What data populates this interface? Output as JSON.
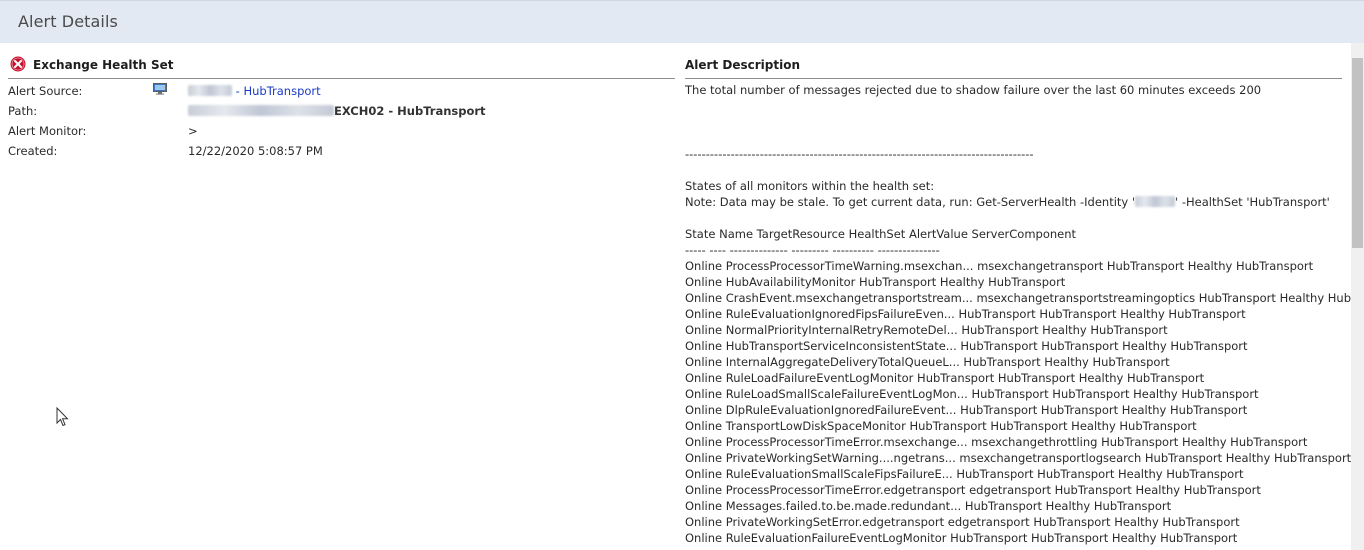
{
  "header": {
    "title": "Alert Details"
  },
  "alert": {
    "section_title": "Exchange Health Set",
    "source_label": "Alert Source:",
    "source_value_suffix": " - HubTransport",
    "path_label": "Path:",
    "path_value_suffix": "EXCH02 - HubTransport",
    "monitor_label": "Alert Monitor:",
    "monitor_value": ">",
    "created_label": "Created:",
    "created_value": "12/22/2020 5:08:57 PM"
  },
  "description": {
    "title": "Alert Description",
    "summary": "The total number of messages rejected due to shadow failure over the last 60 minutes exceeds 200",
    "separator": "------------------------------------------------------------------------------------",
    "states_intro": "States of all monitors within the health set:",
    "note_prefix": "Note: Data may be stale. To get current data, run: Get-ServerHealth -Identity '",
    "note_suffix": "' -HealthSet 'HubTransport'",
    "table_header": "State Name TargetResource HealthSet AlertValue ServerComponent",
    "table_rule": "----- ---- -------------- --------- ---------- ---------------",
    "rows": [
      "Online ProcessProcessorTimeWarning.msexchan... msexchangetransport HubTransport Healthy HubTransport",
      "Online HubAvailabilityMonitor HubTransport Healthy HubTransport",
      "Online CrashEvent.msexchangetransportstream... msexchangetransportstreamingoptics HubTransport Healthy HubTransport",
      "Online RuleEvaluationIgnoredFipsFailureEven... HubTransport HubTransport Healthy HubTransport",
      "Online NormalPriorityInternalRetryRemoteDel... HubTransport Healthy HubTransport",
      "Online HubTransportServiceInconsistentState... HubTransport HubTransport Healthy HubTransport",
      "Online InternalAggregateDeliveryTotalQueueL... HubTransport Healthy HubTransport",
      "Online RuleLoadFailureEventLogMonitor HubTransport HubTransport Healthy HubTransport",
      "Online RuleLoadSmallScaleFailureEventLogMon... HubTransport HubTransport Healthy HubTransport",
      "Online DlpRuleEvaluationIgnoredFailureEvent... HubTransport HubTransport Healthy HubTransport",
      "Online TransportLowDiskSpaceMonitor HubTransport HubTransport Healthy HubTransport",
      "Online ProcessProcessorTimeError.msexchange... msexchangethrottling HubTransport Healthy HubTransport",
      "Online PrivateWorkingSetWarning....ngetrans... msexchangetransportlogsearch HubTransport Healthy HubTransport",
      "Online RuleEvaluationSmallScaleFipsFailureE... HubTransport HubTransport Healthy HubTransport",
      "Online ProcessProcessorTimeError.edgetransport edgetransport HubTransport Healthy HubTransport",
      "Online Messages.failed.to.be.made.redundant... HubTransport Healthy HubTransport",
      "Online PrivateWorkingSetError.edgetransport edgetransport HubTransport Healthy HubTransport",
      "Online RuleEvaluationFailureEventLogMonitor HubTransport HubTransport Healthy HubTransport"
    ]
  },
  "icons": {
    "error": "error-circle-icon",
    "monitor": "monitor-icon",
    "cursor": "mouse-cursor-icon"
  },
  "colors": {
    "header_bg": "#e3e9f2",
    "link": "#1a3cc6",
    "error_red": "#c8102e"
  }
}
